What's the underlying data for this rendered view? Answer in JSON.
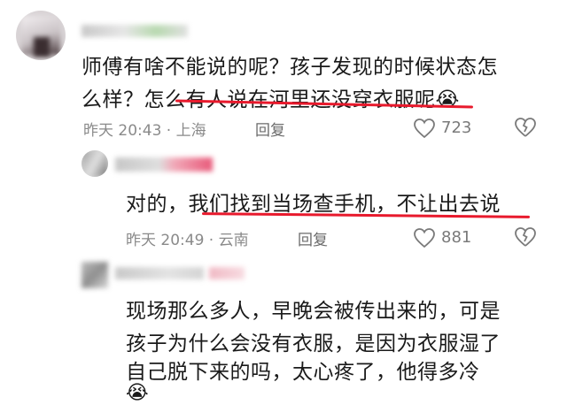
{
  "comments": [
    {
      "text_lines": [
        "师傅有啥不能说的呢？孩子发现的时候状态怎",
        "么样？怎么有人说在河里还没穿衣服呢"
      ],
      "emoji": "😭",
      "time": "昨天 20:43",
      "location": "上海",
      "reply_label": "回复",
      "likes": "723"
    },
    {
      "text_lines": [
        "对的，我们找到当场查手机，不让出去说"
      ],
      "time": "昨天 20:49",
      "location": "云南",
      "reply_label": "回复",
      "likes": "881"
    },
    {
      "text_lines": [
        "现场那么多人，早晚会被传出来的，可是",
        "孩子为什么会没有衣服，是因为衣服湿了",
        "自己脱下来的吗，太心疼了，他得多冷"
      ],
      "emoji": "😭"
    }
  ],
  "colors": {
    "underline": "#e8192c",
    "meta": "#8a8a8a"
  },
  "icons": [
    "avatar",
    "heart-icon",
    "broken-heart-icon"
  ]
}
